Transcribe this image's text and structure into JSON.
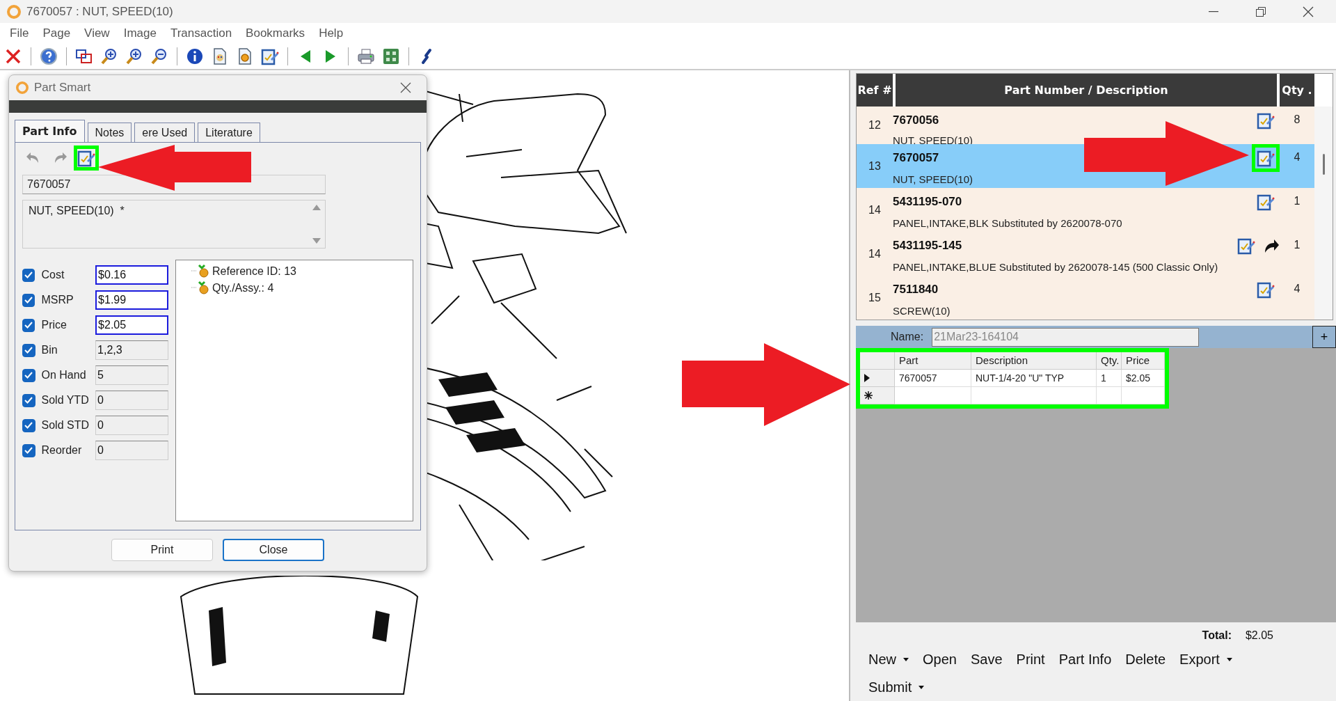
{
  "window": {
    "title": "7670057 : NUT, SPEED(10)"
  },
  "menu": [
    "File",
    "Page",
    "View",
    "Image",
    "Transaction",
    "Bookmarks",
    "Help"
  ],
  "toolbar": [
    {
      "kind": "delete"
    },
    {
      "kind": "sep"
    },
    {
      "kind": "help"
    },
    {
      "kind": "sep"
    },
    {
      "kind": "windows"
    },
    {
      "kind": "zoom-fit"
    },
    {
      "kind": "zoom-in"
    },
    {
      "kind": "zoom-out"
    },
    {
      "kind": "sep"
    },
    {
      "kind": "info"
    },
    {
      "kind": "doc-palette"
    },
    {
      "kind": "doc-gear"
    },
    {
      "kind": "part-edit"
    },
    {
      "kind": "sep"
    },
    {
      "kind": "back"
    },
    {
      "kind": "forward"
    },
    {
      "kind": "sep"
    },
    {
      "kind": "print"
    },
    {
      "kind": "grid"
    },
    {
      "kind": "sep"
    },
    {
      "kind": "link"
    }
  ],
  "dialog": {
    "title": "Part Smart",
    "tabs": [
      {
        "label": "Part Info",
        "selected": true
      },
      {
        "label": "Notes",
        "selected": false
      },
      {
        "label": "ere Used",
        "selected": false
      },
      {
        "label": "Literature",
        "selected": false
      }
    ],
    "tools": [
      {
        "kind": "undo",
        "highlighted": false
      },
      {
        "kind": "redo",
        "highlighted": false
      },
      {
        "kind": "part-edit",
        "highlighted": true
      }
    ],
    "part_number": "7670057",
    "description": "NUT, SPEED(10)  *",
    "fields": [
      {
        "label": "Cost",
        "checked": true,
        "value": "$0.16",
        "editable": true
      },
      {
        "label": "MSRP",
        "checked": true,
        "value": "$1.99",
        "editable": true
      },
      {
        "label": "Price",
        "checked": true,
        "value": "$2.05",
        "editable": true
      },
      {
        "label": "Bin",
        "checked": true,
        "value": "1,2,3",
        "editable": false
      },
      {
        "label": "On Hand",
        "checked": true,
        "value": "5",
        "editable": false
      },
      {
        "label": "Sold YTD",
        "checked": true,
        "value": "0",
        "editable": false
      },
      {
        "label": "Sold STD",
        "checked": true,
        "value": "0",
        "editable": false
      },
      {
        "label": "Reorder",
        "checked": true,
        "value": "0",
        "editable": false
      }
    ],
    "tree": [
      {
        "label": "Reference ID: 13"
      },
      {
        "label": "Qty./Assy.: 4"
      }
    ],
    "buttons": [
      {
        "label": "Print",
        "default": false
      },
      {
        "label": "Close",
        "default": true
      }
    ]
  },
  "parts_list": {
    "columns": [
      "Ref #",
      "Part Number / Description",
      "Qty ."
    ],
    "rows": [
      {
        "ref": "12",
        "part": "7670056",
        "description": "NUT, SPEED(10)",
        "qty": "8",
        "selected": false,
        "redirect": false,
        "highlighted": false
      },
      {
        "ref": "13",
        "part": "7670057",
        "description": "NUT, SPEED(10)",
        "qty": "4",
        "selected": true,
        "redirect": false,
        "highlighted": true
      },
      {
        "ref": "14",
        "part": "5431195-070",
        "description": "PANEL,INTAKE,BLK Substituted by 2620078-070",
        "qty": "1",
        "selected": false,
        "redirect": false,
        "highlighted": false
      },
      {
        "ref": "14",
        "part": "5431195-145",
        "description": "PANEL,INTAKE,BLUE Substituted by 2620078-145 (500 Classic Only)",
        "qty": "1",
        "selected": false,
        "redirect": true,
        "highlighted": false
      },
      {
        "ref": "15",
        "part": "7511840",
        "description": "SCREW(10)",
        "qty": "4",
        "selected": false,
        "redirect": false,
        "highlighted": false
      }
    ]
  },
  "cart": {
    "name_label": "Name:",
    "name_value": "21Mar23-164104",
    "add": "+",
    "highlighted": true,
    "columns": [
      "Part",
      "Description",
      "Qty.",
      "Price"
    ],
    "rows": [
      {
        "cells": [
          "7670057",
          "NUT-1/4-20 \"U\" TYP",
          "1",
          "$2.05"
        ],
        "current": true
      }
    ],
    "new_row": true,
    "total_label": "Total:",
    "total_value": "$2.05",
    "actions": [
      {
        "label": "New",
        "dropdown": true
      },
      {
        "label": "Open",
        "dropdown": false
      },
      {
        "label": "Save",
        "dropdown": false
      },
      {
        "label": "Print",
        "dropdown": false
      },
      {
        "label": "Part Info",
        "dropdown": false
      },
      {
        "label": "Delete",
        "dropdown": false
      },
      {
        "label": "Export",
        "dropdown": true
      },
      {
        "label": "Submit",
        "dropdown": true
      }
    ]
  }
}
